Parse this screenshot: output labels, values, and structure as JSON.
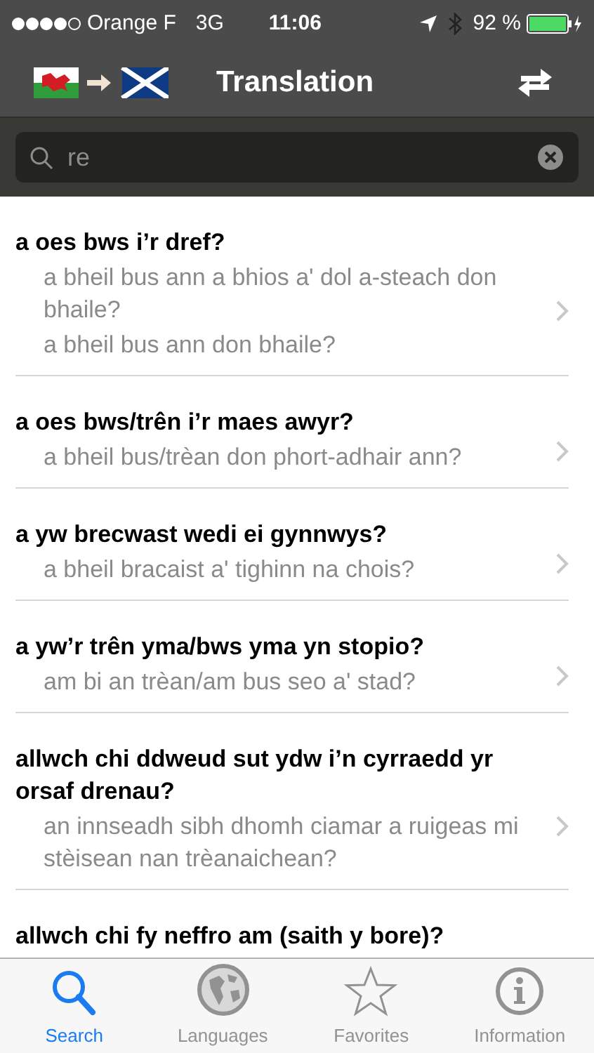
{
  "status_bar": {
    "carrier": "Orange F",
    "network": "3G",
    "time": "11:06",
    "battery": "92 %"
  },
  "nav": {
    "title": "Translation"
  },
  "search": {
    "value": "re"
  },
  "entries": [
    {
      "phrase": "a oes bws i’r dref?",
      "translations": [
        "a bheil bus ann a bhios a' dol a-steach don bhaile?",
        "a bheil bus ann don bhaile?"
      ]
    },
    {
      "phrase": "a oes bws/trên i’r maes awyr?",
      "translations": [
        "a bheil bus/trèan don phort-adhair ann?"
      ]
    },
    {
      "phrase": "a yw brecwast wedi ei gynnwys?",
      "translations": [
        "a bheil bracaist a' tighinn na chois?"
      ]
    },
    {
      "phrase": "a yw’r trên yma/bws yma yn stopio?",
      "translations": [
        "am bi an trèan/am bus seo a' stad?"
      ]
    },
    {
      "phrase": "allwch chi ddweud sut ydw i’n cyrraedd yr orsaf drenau?",
      "translations": [
        "an innseadh sibh dhomh ciamar a ruigeas mi stèisean nan trèanaichean?"
      ]
    },
    {
      "phrase": "allwch chi fy neffro am (saith y bore)?"
    }
  ],
  "tabs": [
    {
      "kind": "search",
      "label": "Search",
      "selected": true
    },
    {
      "kind": "globe",
      "label": "Languages",
      "selected": false
    },
    {
      "kind": "star",
      "label": "Favorites",
      "selected": false
    },
    {
      "kind": "info",
      "label": "Information",
      "selected": false
    }
  ]
}
